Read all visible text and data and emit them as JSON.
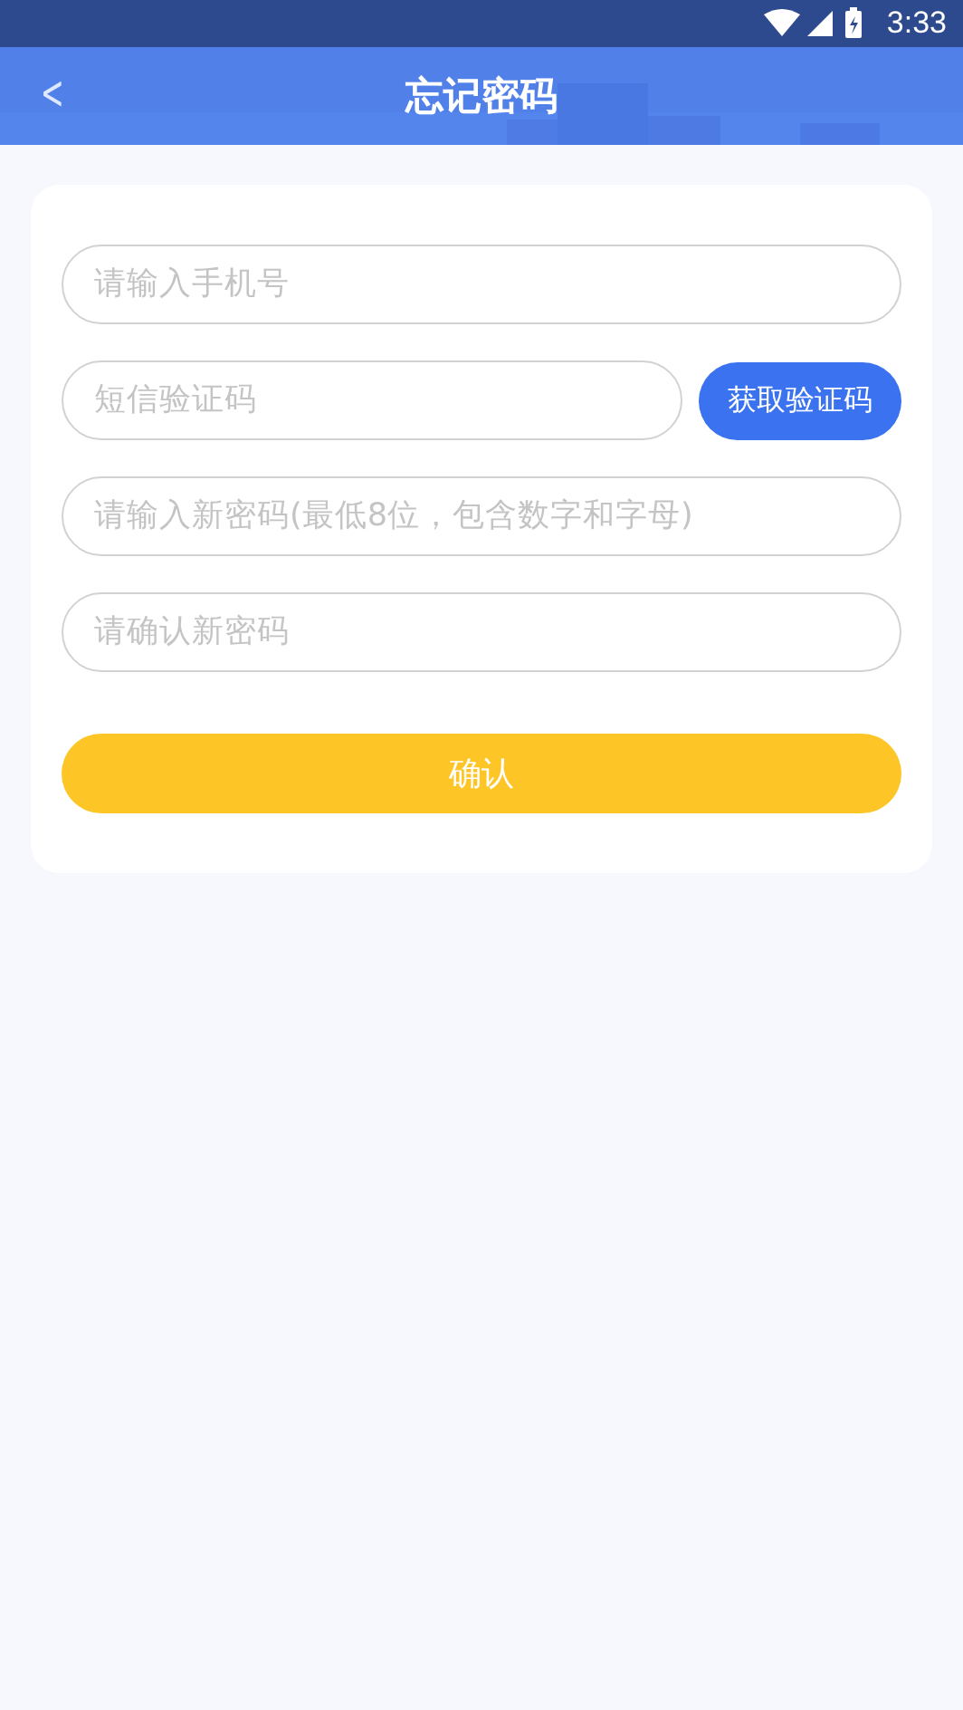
{
  "status_bar": {
    "time": "3:33"
  },
  "header": {
    "back": "<",
    "title": "忘记密码"
  },
  "form": {
    "fields": [
      {
        "kind": "text",
        "placeholder": "请输入手机号"
      },
      {
        "kind": "code",
        "placeholder": "短信验证码",
        "button": "获取验证码"
      },
      {
        "kind": "text",
        "placeholder": "请输入新密码(最低8位，包含数字和字母)"
      },
      {
        "kind": "text",
        "placeholder": "请确认新密码"
      }
    ],
    "submit": "确认"
  }
}
